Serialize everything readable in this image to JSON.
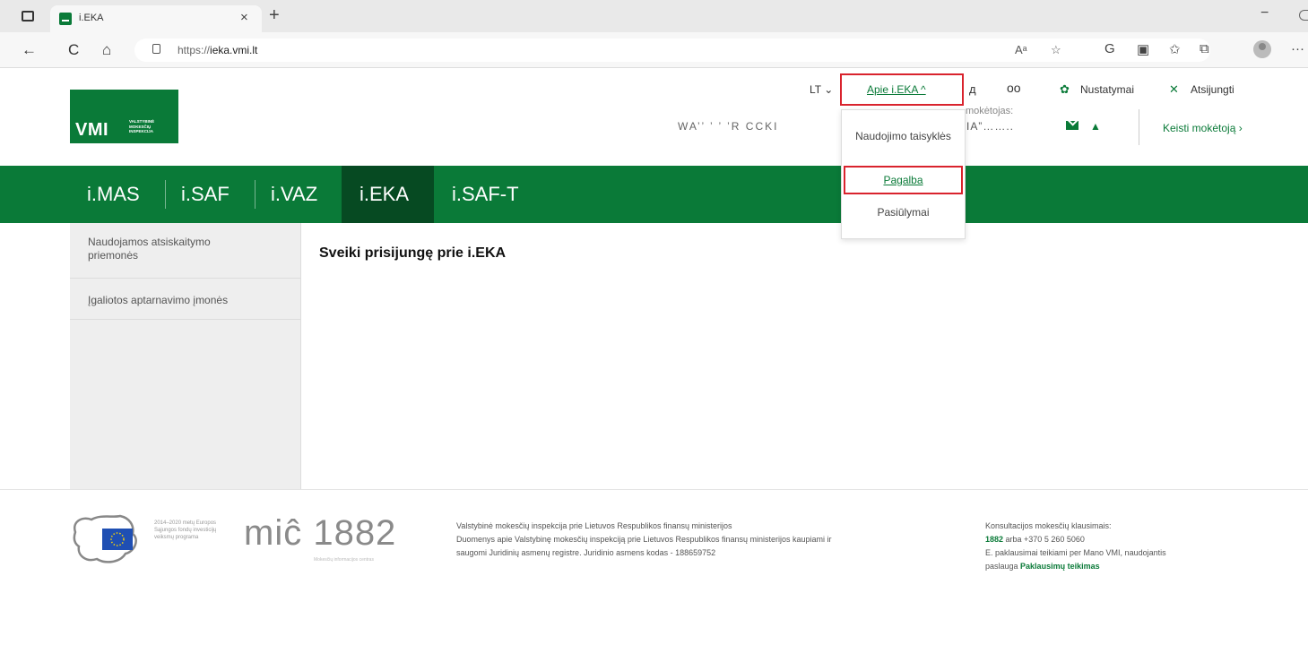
{
  "browser": {
    "tab_title": "i.EKA",
    "tab_close": "×",
    "new_tab": "+",
    "minimize": "−",
    "url_prefix": "https://",
    "url_host": "ieka.vmi.lt",
    "nav": {
      "back": "←",
      "refresh": "C",
      "home": "⌂"
    },
    "toolbar_icons": [
      "read-aloud",
      "favorite-add",
      "refresh-page",
      "split-screen",
      "favorites",
      "collections",
      "profile",
      "more"
    ],
    "toolbar_glyphs": {
      "read_aloud": "Aᵃ",
      "favorite_add": "☆",
      "refresh_page": "G",
      "split": "▣",
      "favorites": "✩",
      "collections": "⧉",
      "more": "···"
    }
  },
  "header": {
    "logo": {
      "text": "VMI",
      "subtitle": "VALSTYBINĖ MOKESČIŲ INSPEKCIJA"
    },
    "lang": "LT ⌄",
    "apie": "Apie i.EKA ^",
    "nustatymai": "Nustatymai",
    "atsijungti": "Atsijungti",
    "moketojas_label": "mokėtojas:",
    "moketojas_name": "IA”……..",
    "user_name": "WA’’  ’  ’     ’R CCKI",
    "keisti": "Keisti mokėtoją ›",
    "glasses_glyph": "oo",
    "gear_glyph": "✿",
    "close_glyph": "✕",
    "ring_glyph": "д",
    "bell_glyph": "▲"
  },
  "dropdown": {
    "items": [
      "Naudojimo taisyklės",
      "Pagalba",
      "Pasiūlymai"
    ]
  },
  "nav": {
    "items": [
      "i.MAS",
      "i.SAF",
      "i.VAZ",
      "i.EKA",
      "i.SAF-T"
    ],
    "active": "i.EKA"
  },
  "sidebar": {
    "items": [
      "Naudojamos atsiskaitymo priemonės",
      "Įgaliotos aptarnavimo įmonės"
    ]
  },
  "main": {
    "welcome": "Sveiki prisijungę prie i.EKA"
  },
  "footer": {
    "eu_text": "2014–2020 metų Europos Sąjungos fondų investicijų veiksmų programa",
    "mic": "miĉ 1882",
    "mic_sub": "Mokesčių informacijos centras",
    "col1": [
      "Valstybinė mokesčių inspekcija prie Lietuvos Respublikos finansų ministerijos",
      "Duomenys apie Valstybinę mokesčių inspekciją prie Lietuvos Respublikos finansų ministerijos kaupiami ir",
      "saugomi Juridinių asmenų registre. Juridinio asmens kodas - 188659752"
    ],
    "col2_title": "Konsultacijos mokesčių klausimais:",
    "col2_phone": "1882",
    "col2_phone_rest": " arba +370 5 260 5060",
    "col2_line3": "E. paklausimai teikiami per Mano VMI, naudojantis",
    "col2_line4_pre": "paslauga ",
    "col2_line4_link": "Paklausimų teikimas"
  },
  "colors": {
    "brand_green": "#0a7a38",
    "nav_active": "#064a22",
    "highlight_red": "#d9232d"
  }
}
